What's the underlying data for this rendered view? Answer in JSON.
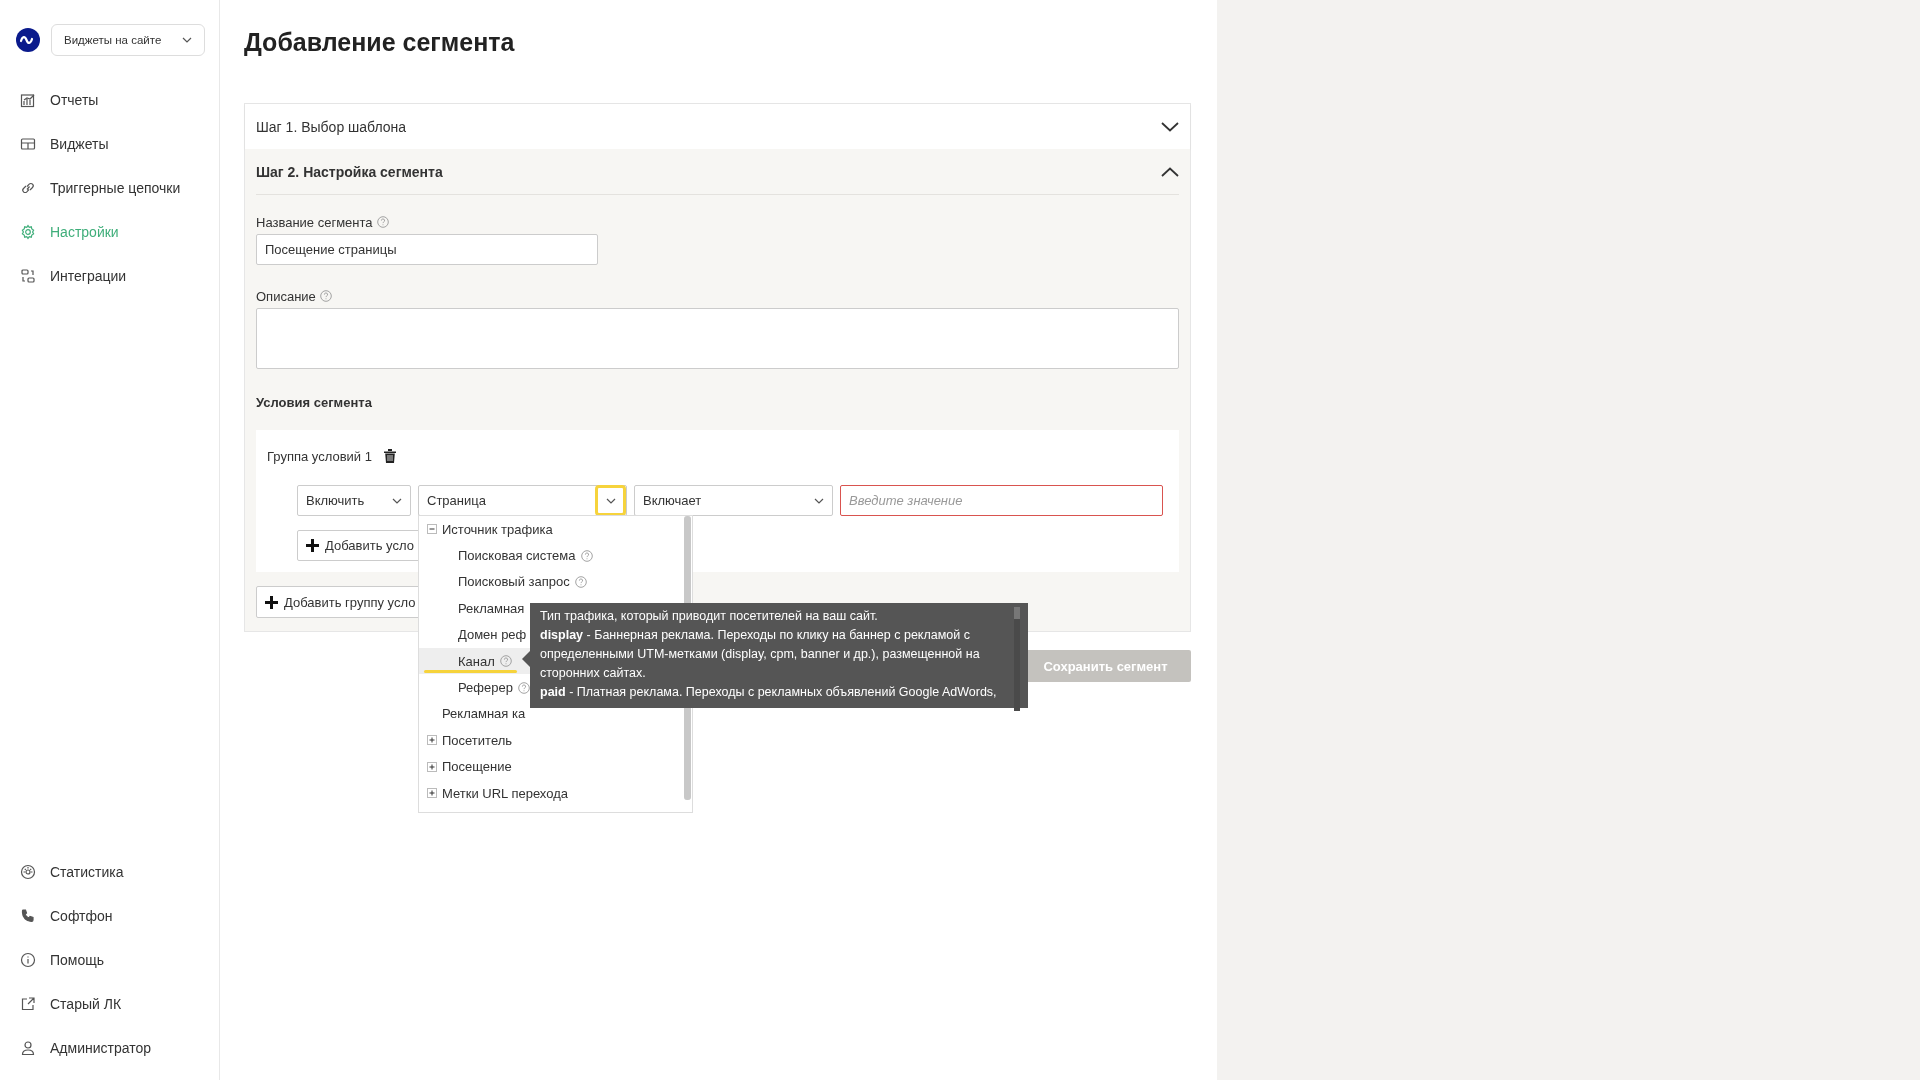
{
  "sidebar": {
    "account_select": {
      "value": "Виджеты на сайте"
    },
    "nav_items": [
      {
        "label": "Отчеты",
        "selected": false
      },
      {
        "label": "Виджеты",
        "selected": false
      },
      {
        "label": "Триггерные цепочки",
        "selected": false
      },
      {
        "label": "Настройки",
        "selected": true
      },
      {
        "label": "Интеграции",
        "selected": false
      }
    ],
    "bottom_items": [
      {
        "label": "Статистика",
        "selected": false
      },
      {
        "label": "Софтфон",
        "selected": false
      },
      {
        "label": "Помощь",
        "selected": false
      },
      {
        "label": "Старый ЛК",
        "selected": false
      },
      {
        "label": "Администратор",
        "selected": false
      }
    ]
  },
  "page": {
    "title": "Добавление сегмента"
  },
  "steps": [
    {
      "title": "Шаг 1. Выбор шаблона",
      "expanded": false
    },
    {
      "title": "Шаг 2. Настройка сегмента",
      "expanded": true
    }
  ],
  "form": {
    "name_label": "Название сегмента",
    "name_value": "Посещение страницы",
    "description_label": "Описание",
    "conditions_title": "Условия сегмента",
    "group": {
      "title": "Группа условий 1",
      "selects": [
        {
          "value": "Включить"
        },
        {
          "value": "Страница"
        },
        {
          "value": "Включает"
        }
      ],
      "value_field": {
        "placeholder": "Введите значение",
        "invalid": true
      },
      "add_condition": "Добавить усло"
    },
    "add_group": "Добавить группу усло",
    "save_button": {
      "label": "Сохранить сегмент",
      "disabled": true
    }
  },
  "dropdown": {
    "items": [
      {
        "label": "Источник трафика",
        "kind": "group",
        "expanded": true,
        "children": [
          {
            "label": "Поисковая система",
            "help": true,
            "highlighted": false
          },
          {
            "label": "Поисковый запрос",
            "help": true,
            "highlighted": false
          },
          {
            "label": "Рекламная",
            "help": false,
            "highlighted": false
          },
          {
            "label": "Домен реф",
            "help": false,
            "highlighted": false
          },
          {
            "label": "Канал",
            "help": true,
            "highlighted": true
          },
          {
            "label": "Реферер",
            "help": true,
            "highlighted": false
          }
        ]
      },
      {
        "label": "Рекламная ка",
        "kind": "leaf"
      },
      {
        "label": "Посетитель",
        "kind": "group",
        "expanded": false
      },
      {
        "label": "Посещение",
        "kind": "group",
        "expanded": false
      },
      {
        "label": "Метки URL перехода",
        "kind": "group",
        "expanded": false
      }
    ]
  },
  "tooltip": {
    "lines": [
      "Тип трафика, который приводит посетителей на ваш сайт.",
      "**display** - Баннерная реклама. Переходы по клику на баннер с рекламой с определенными UTM-метками (display, cpm, banner и др.), размещенной на сторонних сайтах.",
      "**paid** - Платная реклама. Переходы с рекламных объявлений Google AdWords,"
    ]
  }
}
